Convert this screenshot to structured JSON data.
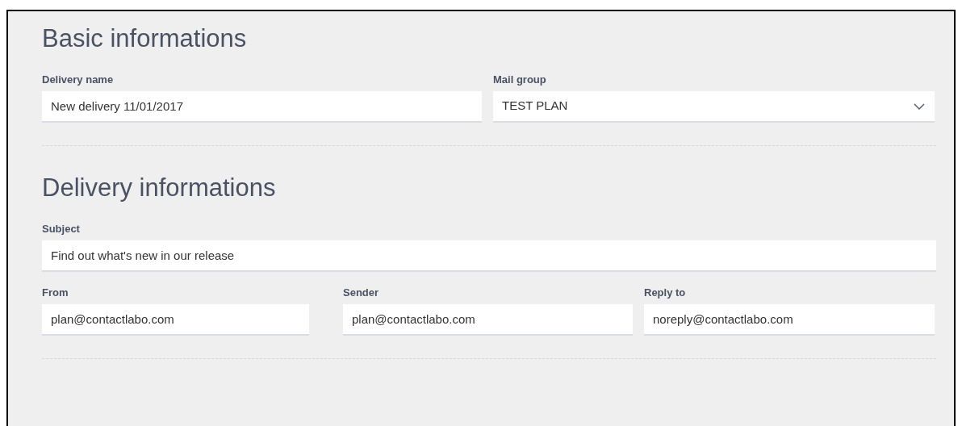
{
  "sections": [
    {
      "title": "Basic informations",
      "rows": [
        [
          {
            "label": "Delivery name",
            "value": "New delivery 11/01/2017",
            "kind": "text"
          },
          {
            "label": "Mail group",
            "value": "TEST PLAN",
            "kind": "select"
          }
        ]
      ]
    },
    {
      "title": "Delivery informations",
      "rows": [
        [
          {
            "label": "Subject",
            "value": "Find out what's new in our release",
            "kind": "text"
          }
        ],
        [
          {
            "label": "From",
            "value": "plan@contactlabo.com",
            "kind": "text"
          },
          {
            "label": "Sender",
            "value": "plan@contactlabo.com",
            "kind": "text"
          },
          {
            "label": "Reply to",
            "value": "noreply@contactlabo.com",
            "kind": "text"
          }
        ]
      ]
    }
  ]
}
